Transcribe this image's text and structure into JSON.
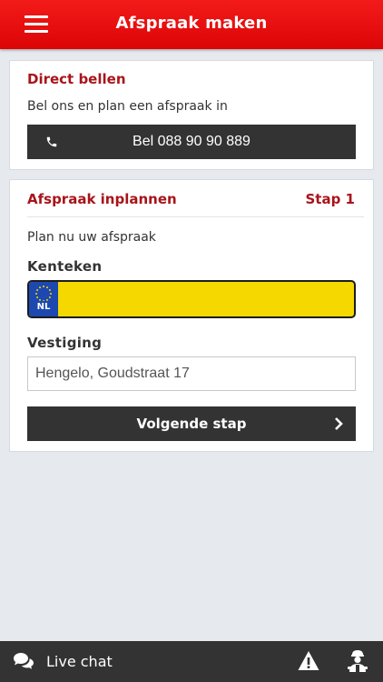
{
  "header": {
    "title": "Afspraak maken",
    "menu_icon": "hamburger-menu-icon",
    "background": "#e8100e"
  },
  "direct_call": {
    "title": "Direct bellen",
    "description": "Bel ons en plan een afspraak in",
    "call_button_label": "Bel 088 90 90 889",
    "call_icon": "phone-icon"
  },
  "appointment": {
    "title": "Afspraak inplannen",
    "step": "Stap 1",
    "description": "Plan nu uw afspraak",
    "license_label": "Kenteken",
    "license_plate": {
      "country_code": "NL",
      "value": "",
      "plate_color": "#f5d800",
      "eu_band_color": "#1d48b0"
    },
    "location_label": "Vestiging",
    "location_value": "Hengelo, Goudstraat 17",
    "next_button_label": "Volgende stap",
    "next_icon": "chevron-right-icon"
  },
  "bottom_bar": {
    "chat_label": "Live chat",
    "chat_icon": "chat-bubbles-icon",
    "warning_icon": "warning-icon",
    "assistance_icon": "roadside-assistance-icon"
  },
  "colors": {
    "accent": "#a8141a",
    "dark_button": "#333333",
    "page_background": "#e6e9ed"
  }
}
